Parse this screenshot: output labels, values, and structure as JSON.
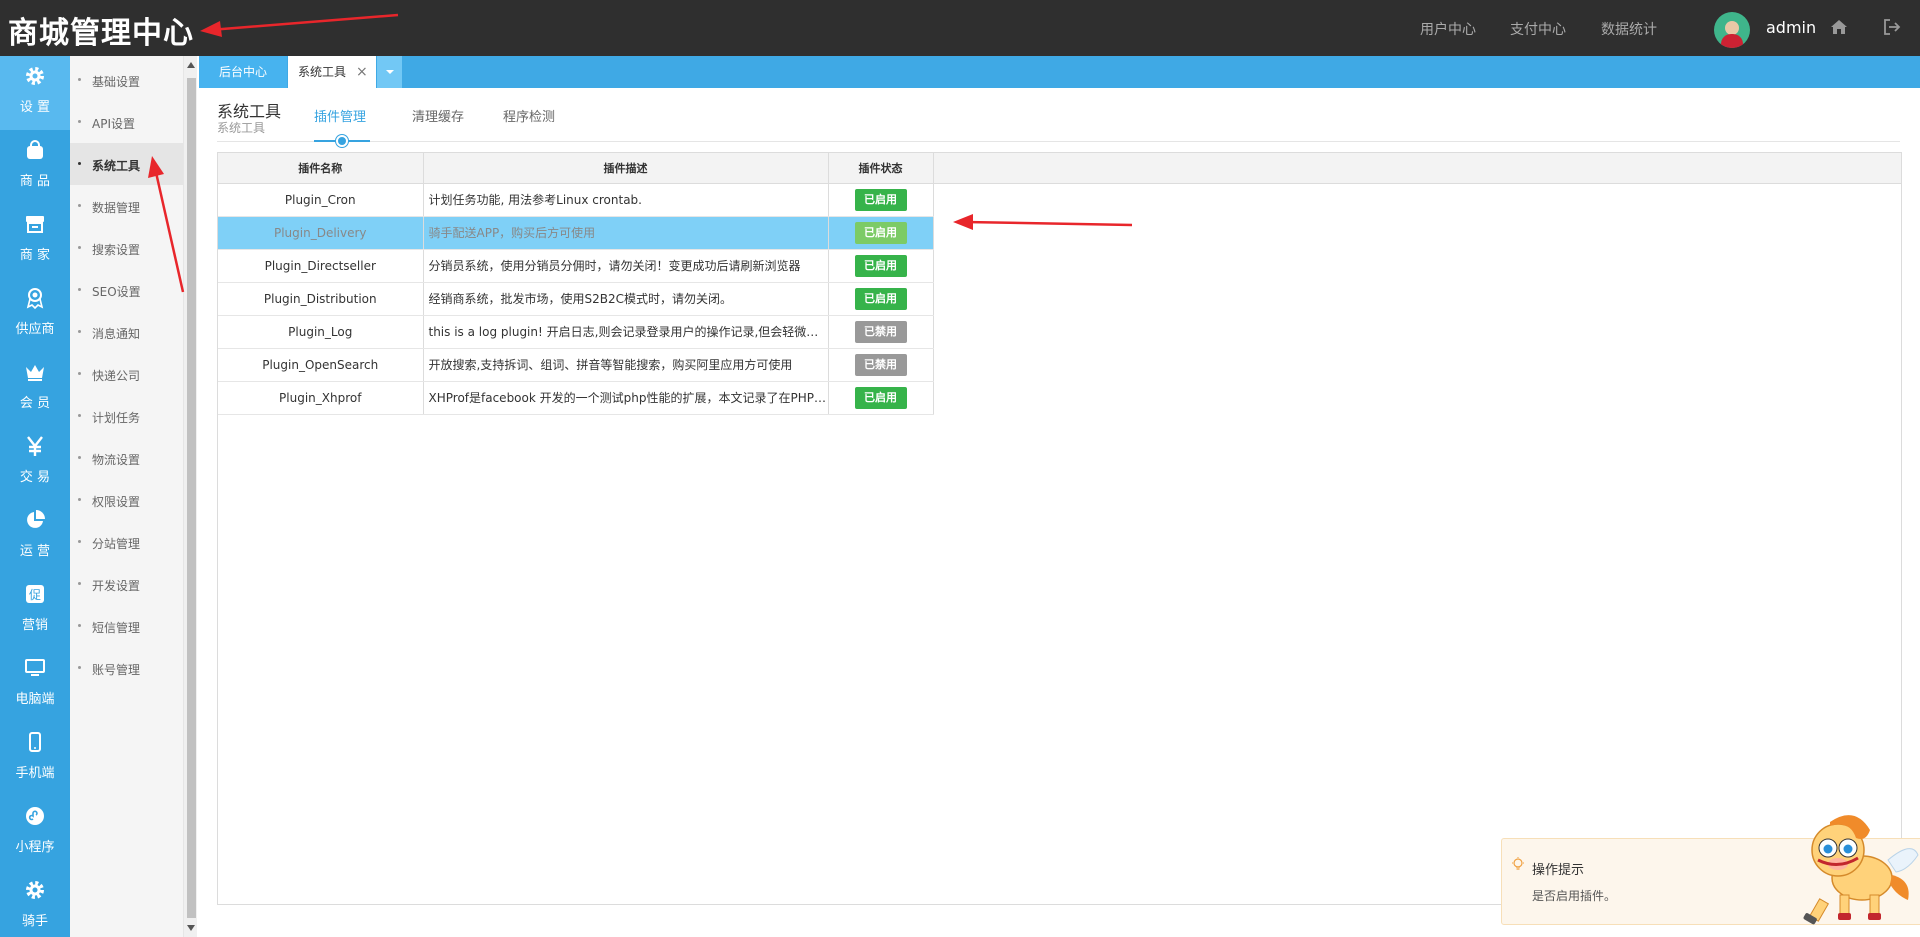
{
  "header": {
    "brand": "商城管理中心",
    "nav": [
      "用户中心",
      "支付中心",
      "数据统计"
    ],
    "user": "admin"
  },
  "sidebar": {
    "items": [
      {
        "label": "设 置",
        "icon": "gear-icon"
      },
      {
        "label": "商 品",
        "icon": "shopping-bag-icon"
      },
      {
        "label": "商 家",
        "icon": "store-icon"
      },
      {
        "label": "供应商",
        "icon": "award-icon"
      },
      {
        "label": "会 员",
        "icon": "crown-icon"
      },
      {
        "label": "交 易",
        "icon": "yen-icon"
      },
      {
        "label": "运 营",
        "icon": "pie-chart-icon"
      },
      {
        "label": "营销",
        "icon": "promo-icon"
      },
      {
        "label": "电脑端",
        "icon": "monitor-icon"
      },
      {
        "label": "手机端",
        "icon": "mobile-icon"
      },
      {
        "label": "小程序",
        "icon": "mini-program-icon"
      },
      {
        "label": "骑手",
        "icon": "gear-icon"
      }
    ]
  },
  "submenu": {
    "items": [
      "基础设置",
      "API设置",
      "系统工具",
      "数据管理",
      "搜索设置",
      "SEO设置",
      "消息通知",
      "快递公司",
      "计划任务",
      "物流设置",
      "权限设置",
      "分站管理",
      "开发设置",
      "短信管理",
      "账号管理"
    ],
    "active_index": 2
  },
  "tabs": {
    "home": "后台中心",
    "current": "系统工具",
    "close": "×"
  },
  "page": {
    "title": "系统工具",
    "subtitle": "系统工具",
    "subtabs": [
      "插件管理",
      "清理缓存",
      "程序检测"
    ]
  },
  "table": {
    "headers": [
      "插件名称",
      "插件描述",
      "插件状态"
    ],
    "rows": [
      {
        "name": "Plugin_Cron",
        "desc": "计划任务功能, 用法参考Linux crontab.",
        "status": "已启用",
        "enabled": true
      },
      {
        "name": "Plugin_Delivery",
        "desc": "骑手配送APP，购买后方可使用",
        "status": "已启用",
        "enabled": true
      },
      {
        "name": "Plugin_Directseller",
        "desc": "分销员系统，使用分销员分佣时，请勿关闭！变更成功后请刷新浏览器",
        "status": "已启用",
        "enabled": true
      },
      {
        "name": "Plugin_Distribution",
        "desc": "经销商系统，批发市场，使用S2B2C模式时，请勿关闭。",
        "status": "已启用",
        "enabled": true
      },
      {
        "name": "Plugin_Log",
        "desc": "this is a log plugin! 开启日志,则会记录登录用户的操作记录,但会轻微加…",
        "status": "已禁用",
        "enabled": false
      },
      {
        "name": "Plugin_OpenSearch",
        "desc": "开放搜索,支持拆词、组词、拼音等智能搜索，购买阿里应用方可使用",
        "status": "已禁用",
        "enabled": false
      },
      {
        "name": "Plugin_Xhprof",
        "desc": "XHProf是facebook 开发的一个测试php性能的扩展，本文记录了在PHP…",
        "status": "已启用",
        "enabled": true
      }
    ],
    "selected_index": 1
  },
  "toast": {
    "title": "操作提示",
    "message": "是否启用插件。"
  },
  "colors": {
    "sidebar": "#36a3e0",
    "topbar": "#2f2f2f",
    "enabled": "#36b34a",
    "disabled": "#999999",
    "selected_row": "#7fd0f7",
    "annotation": "#e8262b"
  }
}
